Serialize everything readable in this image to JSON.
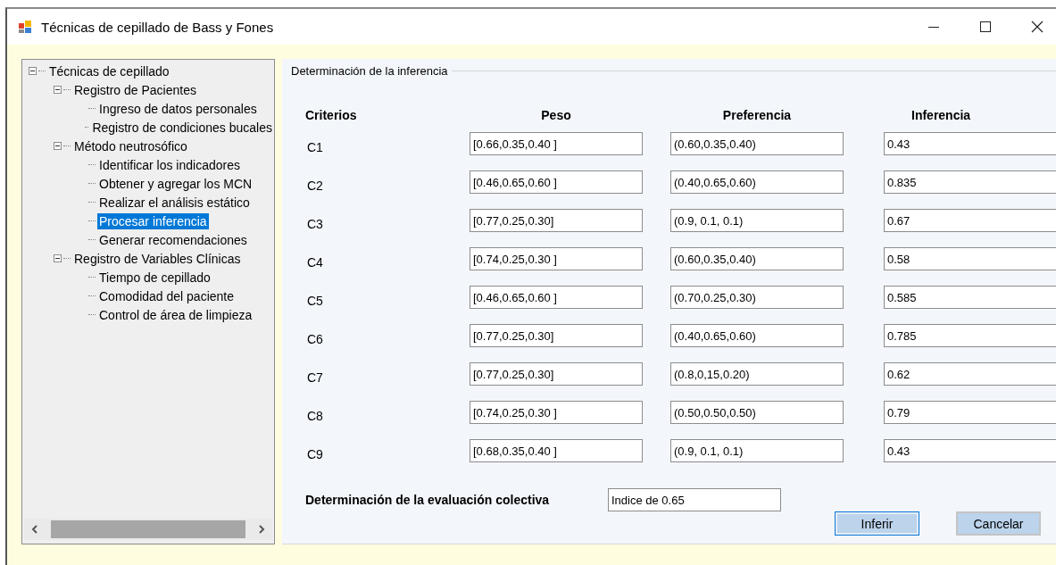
{
  "window": {
    "title": "Técnicas de cepillado de Bass y Fones"
  },
  "tree": {
    "items": [
      {
        "label": "Técnicas de cepillado",
        "expanded": true,
        "selected": false,
        "children": [
          {
            "label": "Registro de Pacientes",
            "expanded": true,
            "selected": false,
            "children": [
              {
                "label": "Ingreso de datos personales",
                "selected": false
              },
              {
                "label": "Registro de condiciones bucales",
                "selected": false
              }
            ]
          },
          {
            "label": "Método neutrosófico",
            "expanded": true,
            "selected": false,
            "children": [
              {
                "label": "Identificar los indicadores",
                "selected": false
              },
              {
                "label": "Obtener y agregar los MCN",
                "selected": false
              },
              {
                "label": "Realizar el análisis estático",
                "selected": false
              },
              {
                "label": "Procesar inferencia",
                "selected": true
              },
              {
                "label": "Generar recomendaciones",
                "selected": false
              }
            ]
          },
          {
            "label": "Registro de Variables Clínicas",
            "expanded": true,
            "selected": false,
            "children": [
              {
                "label": "Tiempo de cepillado",
                "selected": false
              },
              {
                "label": "Comodidad del paciente",
                "selected": false
              },
              {
                "label": "Control de área de limpieza",
                "selected": false
              }
            ]
          }
        ]
      }
    ]
  },
  "group": {
    "title": "Determinación de la inferencia",
    "columns": [
      "Criterios",
      "Peso",
      "Preferencia",
      "Inferencia"
    ],
    "rows": [
      {
        "criterion": "C1",
        "peso": "[0.66,0.35,0.40 ]",
        "preferencia": "(0.60,0.35,0.40)",
        "inferencia": "0.43"
      },
      {
        "criterion": "C2",
        "peso": "[0.46,0.65,0.60 ]",
        "preferencia": "(0.40,0.65,0.60)",
        "inferencia": "0.835"
      },
      {
        "criterion": "C3",
        "peso": "[0.77,0.25,0.30]",
        "preferencia": "(0.9, 0.1, 0.1)",
        "inferencia": "0.67"
      },
      {
        "criterion": "C4",
        "peso": "[0.74,0.25,0.30 ]",
        "preferencia": "(0.60,0.35,0.40)",
        "inferencia": "0.58"
      },
      {
        "criterion": "C5",
        "peso": "[0.46,0.65,0.60 ]",
        "preferencia": "(0.70,0.25,0.30)",
        "inferencia": "0.585"
      },
      {
        "criterion": "C6",
        "peso": "[0.77,0.25,0.30]",
        "preferencia": "(0.40,0.65,0.60)",
        "inferencia": "0.785"
      },
      {
        "criterion": "C7",
        "peso": "[0.77,0.25,0.30]",
        "preferencia": "(0.8,0,15,0.20)",
        "inferencia": "0.62"
      },
      {
        "criterion": "C8",
        "peso": "[0.74,0.25,0.30 ]",
        "preferencia": "(0.50,0.50,0.50)",
        "inferencia": "0.79"
      },
      {
        "criterion": "C9",
        "peso": "[0.68,0.35,0.40 ]",
        "preferencia": "(0.9, 0.1, 0.1)",
        "inferencia": "0.43"
      }
    ],
    "collective": {
      "label": "Determinación de la evaluación colectiva",
      "value": "Indice de 0.65"
    },
    "buttons": [
      {
        "label": "Inferir",
        "focused": true
      },
      {
        "label": "Cancelar",
        "focused": false
      }
    ]
  }
}
